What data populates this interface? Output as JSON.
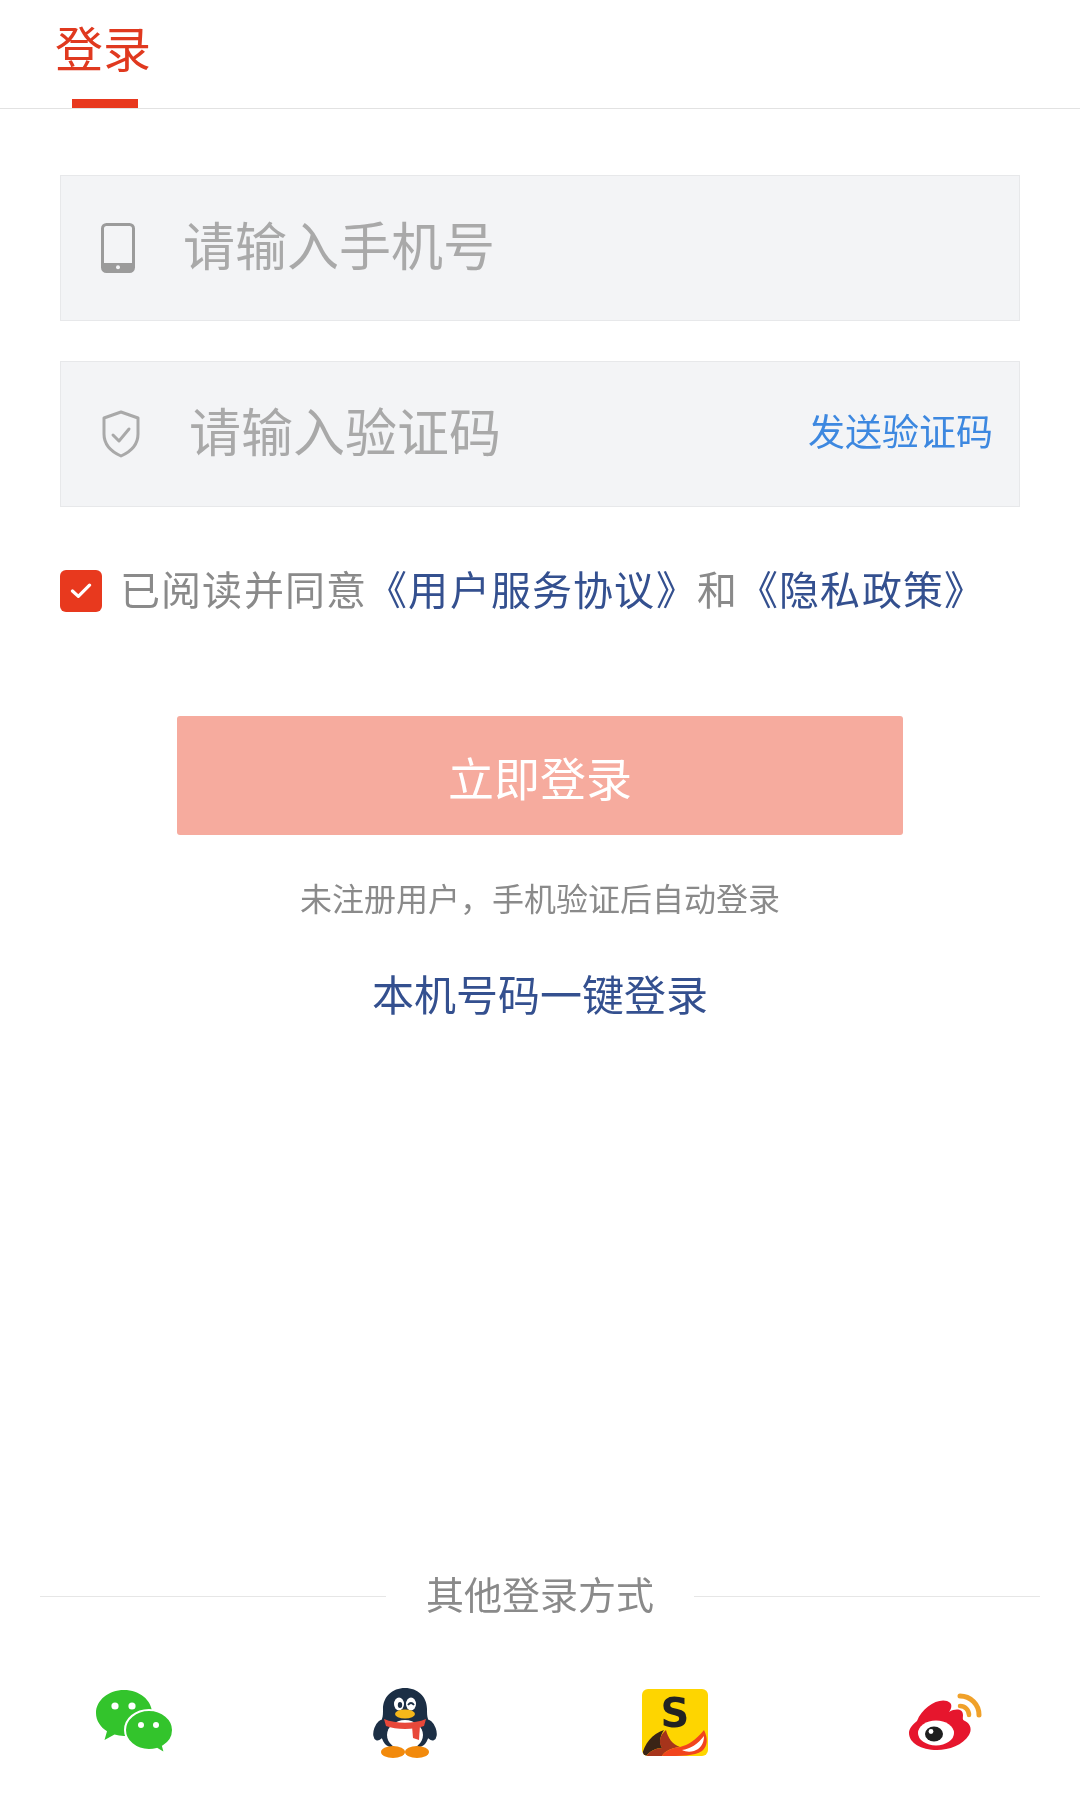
{
  "tabs": [
    {
      "label": "登录",
      "selected": true
    }
  ],
  "phone_field": {
    "placeholder": "请输入手机号"
  },
  "code_field": {
    "placeholder": "请输入验证码",
    "send_code_button": "发送验证码"
  },
  "agreement": {
    "checked": true,
    "parts": [
      {
        "kind": "text",
        "text": "已阅读并同意"
      },
      {
        "kind": "link",
        "text": "《用户服务协议》"
      },
      {
        "kind": "text",
        "text": "和"
      },
      {
        "kind": "link",
        "text": "《隐私政策》"
      }
    ]
  },
  "login_button": {
    "label": "立即登录",
    "disabled": true
  },
  "hint": "未注册用户，手机验证后自动登录",
  "one_click_login": "本机号码一键登录",
  "other_login": {
    "title": "其他登录方式",
    "providers": [
      {
        "kind": "wechat"
      },
      {
        "kind": "qq"
      },
      {
        "kind": "sogou",
        "logo_text": "S"
      },
      {
        "kind": "weibo"
      }
    ]
  }
}
